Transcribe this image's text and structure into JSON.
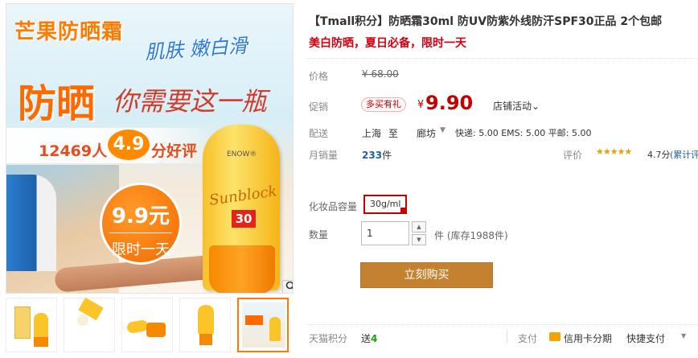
{
  "gallery": {
    "headline": "芒果防晒霜",
    "sub": "肌肤 嫩白滑",
    "big_title": "防晒",
    "slogan": "你需要这一瓶",
    "rating_count": "12469人",
    "rating_score": "4.9",
    "rating_text": "分好评",
    "badge_price": "9.9元",
    "badge_limit": "限时一天",
    "tube_brand": "ENOW®",
    "tube_name": "Sunblock",
    "tube_spf": "30",
    "zoom_icon": "magnifier-icon",
    "thumbnails": 5
  },
  "product": {
    "title": "【Tmall积分】防晒霜30ml 防UV防紫外线防汗SPF30正品 2个包邮",
    "subtitle": "美白防晒，夏日必备，限时一天"
  },
  "price": {
    "orig_label": "价格",
    "orig_price": "¥ 68.00",
    "promo_label": "促销",
    "promo_tag": "多买有礼",
    "yen": "¥",
    "price": "9.90",
    "store_activity": "店铺活动⌄"
  },
  "shipping": {
    "label": "配送",
    "from": "上海",
    "to": "至",
    "dest": "廊坊",
    "arrow": "▼",
    "info": "快递: 5.00 EMS: 5.00 平邮: 5.00"
  },
  "sales": {
    "label": "月销量",
    "count": "233",
    "unit": "件",
    "review_label": "评价",
    "stars": "★★★★★",
    "score": "4.7分",
    "review_link": "(累计评"
  },
  "spec": {
    "label": "化妆品容量",
    "option": "30g/ml"
  },
  "quantity": {
    "label": "数量",
    "value": "1",
    "up": "▲",
    "down": "▼",
    "stock": "件 (库存1988件)"
  },
  "buy": {
    "label": "立刻购买"
  },
  "footer": {
    "points_label": "天猫积分",
    "points_prefix": "送",
    "points_value": "4",
    "pay_label": "支付",
    "card_text": "信用卡分期",
    "quick_pay": "快捷支付",
    "more_arrow": "▼"
  },
  "colors": {
    "accent": "#c40000",
    "buy_button": "#c48231",
    "orange": "#ff7a00"
  }
}
